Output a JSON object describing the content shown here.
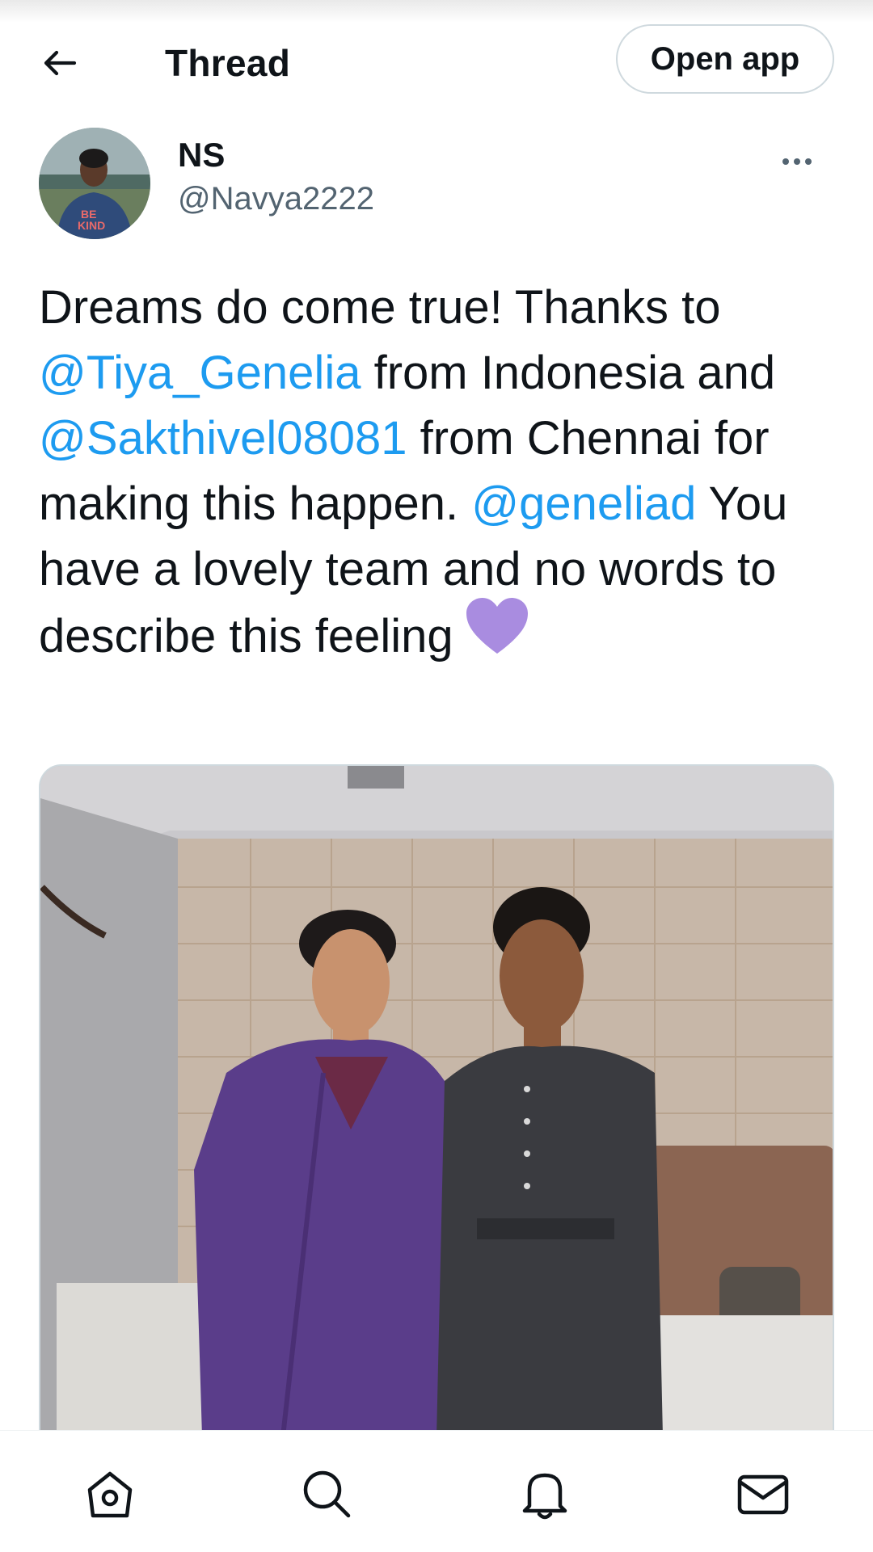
{
  "header": {
    "title": "Thread",
    "open_app_label": "Open app"
  },
  "tweet": {
    "author_name": "NS",
    "author_handle": "@Navya2222",
    "text_segments": [
      {
        "text": "Dreams do come true! Thanks to ",
        "type": "text"
      },
      {
        "text": "@Tiya_Genelia",
        "type": "mention"
      },
      {
        "text": " from Indonesia and ",
        "type": "text"
      },
      {
        "text": "@Sakthivel08081",
        "type": "mention"
      },
      {
        "text": " from Chennai for making this happen. ",
        "type": "text"
      },
      {
        "text": "@geneliad",
        "type": "mention"
      },
      {
        "text": " You have a lovely team and no words to describe this feeling",
        "type": "text"
      }
    ],
    "emoji": "purple-heart"
  },
  "colors": {
    "link": "#1d9bf0",
    "text": "#0f1419",
    "secondary": "#536471",
    "border": "#cfd9de",
    "heart": "#a98ce0"
  },
  "nav": [
    "home-icon",
    "search-icon",
    "notifications-icon",
    "messages-icon"
  ]
}
